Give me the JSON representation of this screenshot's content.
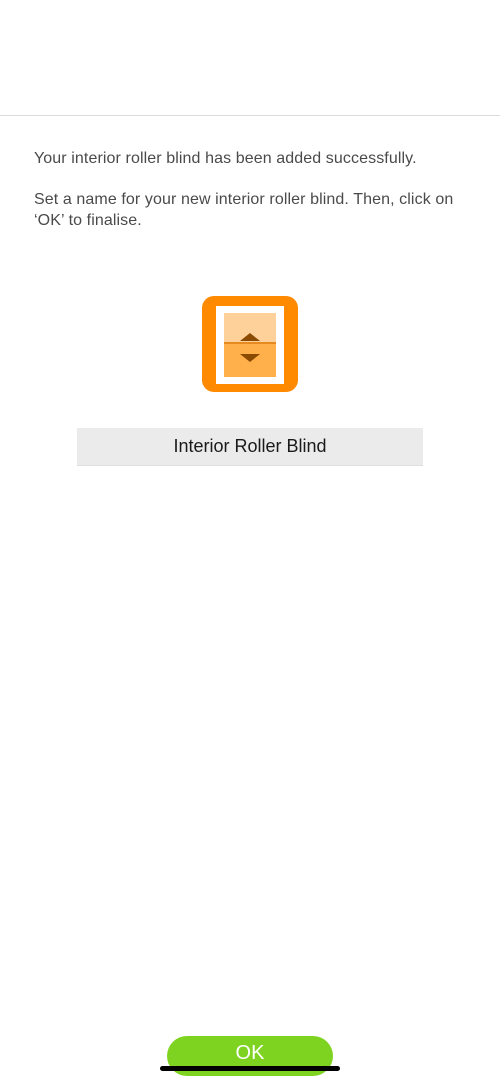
{
  "messages": {
    "success": "Your interior roller blind has been added successfully.",
    "instruction": "Set a name for your new interior roller blind. Then, click on ‘OK’ to finalise."
  },
  "device_icon": {
    "name": "roller-blind-icon",
    "color_outer": "#ff8a00",
    "color_frame": "#ffffff",
    "color_blind_top": "#ffd19a",
    "color_blind_bottom": "#ffb04a",
    "color_arrows": "#8a4a00"
  },
  "name_input": {
    "value": "Interior Roller Blind"
  },
  "ok_button": {
    "label": "OK",
    "color": "#7ed321"
  }
}
